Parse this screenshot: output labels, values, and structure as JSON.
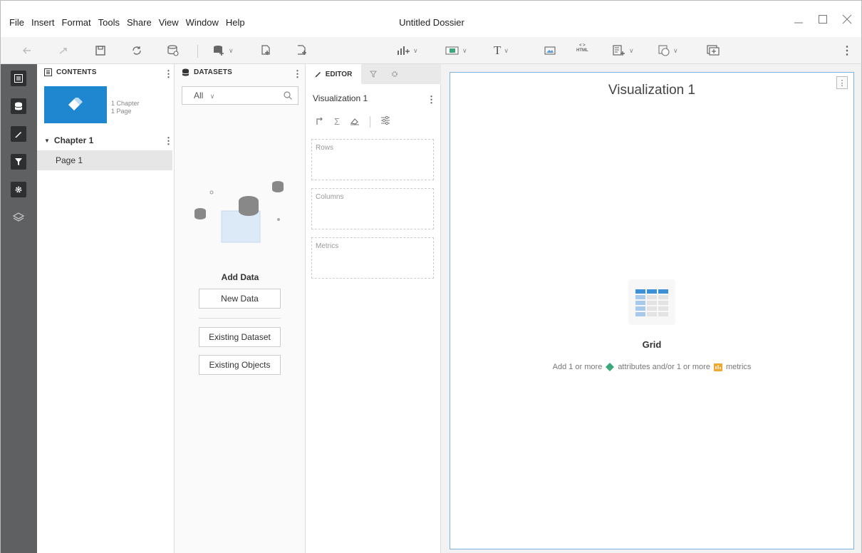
{
  "menu": [
    "File",
    "Insert",
    "Format",
    "Tools",
    "Share",
    "View",
    "Window",
    "Help"
  ],
  "window_title": "Untitled Dossier",
  "contents": {
    "header": "CONTENTS",
    "thumb_meta": [
      "1 Chapter",
      "1 Page"
    ],
    "chapter_label": "Chapter 1",
    "page_label": "Page 1"
  },
  "datasets": {
    "header": "DATASETS",
    "filter_value": "All",
    "add_data_label": "Add Data",
    "new_data_label": "New Data",
    "existing_dataset_label": "Existing Dataset",
    "existing_objects_label": "Existing Objects"
  },
  "editor": {
    "tab_label": "EDITOR",
    "viz_name": "Visualization 1",
    "drop_zones": [
      "Rows",
      "Columns",
      "Metrics"
    ]
  },
  "canvas": {
    "viz_title": "Visualization 1",
    "grid_label": "Grid",
    "hint_prefix": "Add 1 or more",
    "hint_attributes": "attributes and/or 1 or more",
    "hint_metrics": "metrics"
  },
  "colors": {
    "rail_bg": "#5e6062",
    "accent_blue": "#1f87d0",
    "attribute_green": "#3aa87a",
    "metric_orange": "#f0a830"
  }
}
